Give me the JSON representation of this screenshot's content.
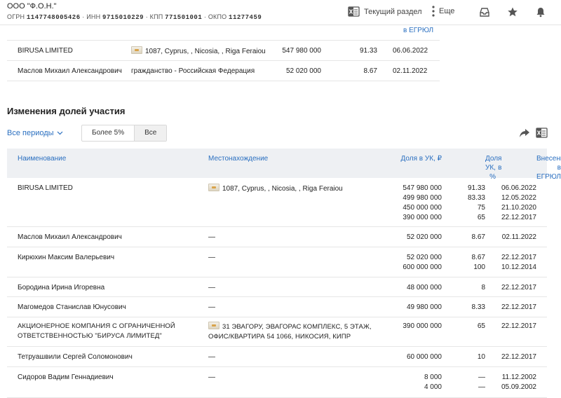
{
  "header": {
    "company_name": "ООО \"Ф.О.Н.\"",
    "ogrn_label": "ОГРН",
    "ogrn": "1147748005426",
    "inn_label": "ИНН",
    "inn": "9715010229",
    "kpp_label": "КПП",
    "kpp": "771501001",
    "okpo_label": "ОКПО",
    "okpo": "11277459",
    "current_section_label": "Текущий раздел",
    "more_label": "Еще"
  },
  "top_table": {
    "header_tail": "в ЕГРЮЛ",
    "rows": [
      {
        "name": "BIRUSA LIMITED",
        "location": "1087, Cyprus, , Nicosia, , Riga Feraiou",
        "amount": "547 980 000",
        "share": "91.33",
        "date": "06.06.2022"
      },
      {
        "name": "Маслов Михаил Александрович",
        "location": "гражданство - Российская Федерация",
        "amount": "52 020 000",
        "share": "8.67",
        "date": "02.11.2022"
      }
    ]
  },
  "section": {
    "title": "Изменения долей участия",
    "period_label": "Все периоды",
    "filter_over5": "Более 5%",
    "filter_all": "Все"
  },
  "table": {
    "columns": {
      "name": "Наименование",
      "location": "Местонахождение",
      "amount": "Доля в УК, ₽",
      "share_line1": "Доля в",
      "share_line2": "УК, %",
      "date_line1": "Внесение",
      "date_line2": "в ЕГРЮЛ"
    },
    "rows": [
      {
        "name": "BIRUSA LIMITED",
        "link": true,
        "location": "1087, Cyprus, , Nicosia, , Riga Feraiou",
        "flag": true,
        "amounts": [
          "547 980 000",
          "499 980 000",
          "450 000 000",
          "390 000 000"
        ],
        "shares": [
          "91.33",
          "83.33",
          "75",
          "65"
        ],
        "dates": [
          "06.06.2022",
          "12.05.2022",
          "21.10.2020",
          "22.12.2017"
        ]
      },
      {
        "name": "Маслов Михаил Александрович",
        "link": true,
        "location": "—",
        "amounts": [
          "52 020 000"
        ],
        "shares": [
          "8.67"
        ],
        "dates": [
          "02.11.2022"
        ]
      },
      {
        "name": "Кирюхин Максим Валерьевич",
        "link": true,
        "location": "—",
        "amounts": [
          "52 020 000",
          "600 000 000"
        ],
        "shares": [
          "8.67",
          "100"
        ],
        "dates": [
          "22.12.2017",
          "10.12.2014"
        ]
      },
      {
        "name": "Бородина Ирина Игоревна",
        "link": true,
        "location": "—",
        "amounts": [
          "48 000 000"
        ],
        "shares": [
          "8"
        ],
        "dates": [
          "22.12.2017"
        ]
      },
      {
        "name": "Магомедов Станислав Юнусович",
        "link": true,
        "location": "—",
        "amounts": [
          "49 980 000"
        ],
        "shares": [
          "8.33"
        ],
        "dates": [
          "22.12.2017"
        ]
      },
      {
        "name_line1": "АКЦИОНЕРНОЕ КОМПАНИЯ С ОГРАНИЧЕННОЙ",
        "name_line2": "ОТВЕТСТВЕННОСТЬЮ \"БИРУСА ЛИМИТЕД\"",
        "link": false,
        "location_line1": "31 ЭВАГОРУ, ЭВАГОРАС КОМПЛЕКС, 5 ЭТАЖ,",
        "location_line2": "ОФИС/КВАРТИРА 54 1066, НИКОСИЯ, КИПР",
        "flag": true,
        "amounts": [
          "390 000 000"
        ],
        "shares": [
          "65"
        ],
        "dates": [
          "22.12.2017"
        ]
      },
      {
        "name": "Тетруашвили Сергей Соломонович",
        "link": true,
        "location": "—",
        "amounts": [
          "60 000 000"
        ],
        "shares": [
          "10"
        ],
        "dates": [
          "22.12.2017"
        ]
      },
      {
        "name": "Сидоров Вадим Геннадиевич",
        "link": true,
        "location": "—",
        "amounts": [
          "8 000",
          "4 000"
        ],
        "shares": [
          "—",
          "—"
        ],
        "dates": [
          "11.12.2002",
          "05.09.2002"
        ]
      }
    ]
  }
}
